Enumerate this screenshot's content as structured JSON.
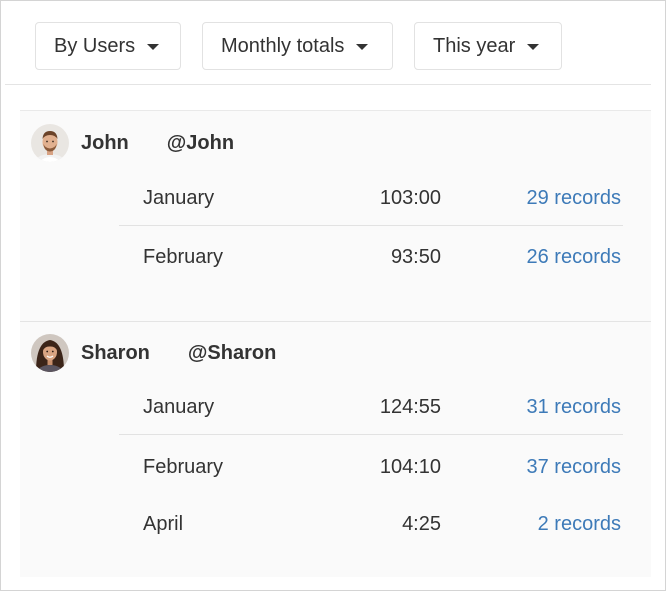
{
  "filters": [
    {
      "label": "By Users"
    },
    {
      "label": "Monthly totals"
    },
    {
      "label": "This year"
    }
  ],
  "users": [
    {
      "name": "John",
      "handle": "@John",
      "rows": [
        {
          "month": "January",
          "total": "103:00",
          "records": "29 records"
        },
        {
          "month": "February",
          "total": "93:50",
          "records": "26 records"
        }
      ]
    },
    {
      "name": "Sharon",
      "handle": "@Sharon",
      "rows": [
        {
          "month": "January",
          "total": "124:55",
          "records": "31 records"
        },
        {
          "month": "February",
          "total": "104:10",
          "records": "37 records"
        },
        {
          "month": "April",
          "total": "4:25",
          "records": "2 records"
        }
      ]
    }
  ],
  "colors": {
    "link": "#3d7ab8",
    "text": "#333333",
    "panel": "#fafafa"
  }
}
